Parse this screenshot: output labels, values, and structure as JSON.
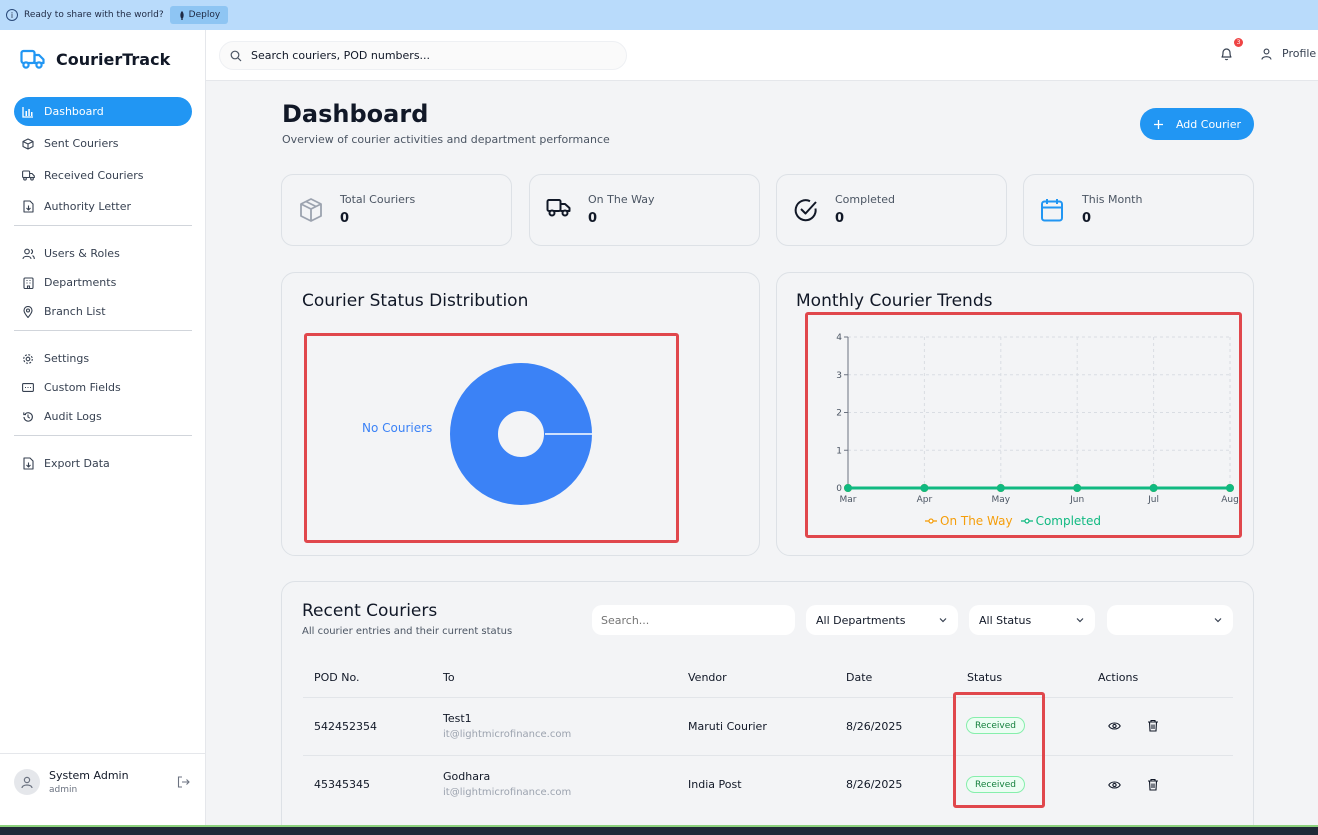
{
  "banner": {
    "text": "Ready to share with the world?",
    "deploy_label": "Deploy"
  },
  "brand": {
    "name": "CourierTrack",
    "accent": "#2196f3"
  },
  "sidebar": {
    "items": [
      {
        "label": "Dashboard",
        "icon": "bar-chart-icon",
        "active": true
      },
      {
        "label": "Sent Couriers",
        "icon": "box-icon"
      },
      {
        "label": "Received Couriers",
        "icon": "truck-icon"
      },
      {
        "label": "Authority Letter",
        "icon": "document-icon"
      },
      {
        "label": "Users & Roles",
        "icon": "users-icon"
      },
      {
        "label": "Departments",
        "icon": "building-icon"
      },
      {
        "label": "Branch List",
        "icon": "map-pin-icon"
      },
      {
        "label": "Settings",
        "icon": "gear-icon"
      },
      {
        "label": "Custom Fields",
        "icon": "form-field-icon"
      },
      {
        "label": "Audit Logs",
        "icon": "history-icon"
      },
      {
        "label": "Export Data",
        "icon": "export-icon"
      }
    ],
    "user": {
      "name": "System Admin",
      "role": "admin"
    }
  },
  "topbar": {
    "search_placeholder": "Search couriers, POD numbers...",
    "notification_count": "3",
    "profile_label": "Profile"
  },
  "header": {
    "title": "Dashboard",
    "subtitle": "Overview of courier activities and department performance",
    "add_button": "Add Courier"
  },
  "stats": [
    {
      "label": "Total Couriers",
      "value": "0",
      "icon": "box-icon"
    },
    {
      "label": "On The Way",
      "value": "0",
      "icon": "truck-icon"
    },
    {
      "label": "Completed",
      "value": "0",
      "icon": "check-circle-icon"
    },
    {
      "label": "This Month",
      "value": "0",
      "icon": "calendar-icon"
    }
  ],
  "status_chart": {
    "title": "Courier Status Distribution",
    "label": "No Couriers",
    "color": "#3b82f6"
  },
  "trend_chart": {
    "title": "Monthly Courier Trends",
    "legend": [
      "On The Way",
      "Completed"
    ],
    "colors": {
      "on_the_way": "#f59e0b",
      "completed": "#10b981"
    }
  },
  "chart_data": [
    {
      "type": "pie",
      "title": "Courier Status Distribution",
      "categories": [
        "No Couriers"
      ],
      "values": [
        1
      ]
    },
    {
      "type": "line",
      "title": "Monthly Courier Trends",
      "x": [
        "Mar",
        "Apr",
        "May",
        "Jun",
        "Jul",
        "Aug"
      ],
      "series": [
        {
          "name": "On The Way",
          "values": [
            0,
            0,
            0,
            0,
            0,
            0
          ]
        },
        {
          "name": "Completed",
          "values": [
            0,
            0,
            0,
            0,
            0,
            0
          ]
        }
      ],
      "ylim": [
        0,
        4
      ],
      "yticks": [
        "0",
        "1",
        "2",
        "3",
        "4"
      ],
      "grid": true,
      "legend": "bottom"
    }
  ],
  "recent": {
    "title": "Recent Couriers",
    "subtitle": "All courier entries and their current status",
    "search_placeholder": "Search...",
    "department_filter": "All Departments",
    "status_filter": "All Status",
    "third_filter": "",
    "columns": [
      "POD No.",
      "To",
      "Vendor",
      "Date",
      "Status",
      "Actions"
    ],
    "rows": [
      {
        "pod": "542452354",
        "to_name": "Test1",
        "to_email": "it@lightmicrofinance.com",
        "vendor": "Maruti Courier",
        "date": "8/26/2025",
        "status": "Received"
      },
      {
        "pod": "45345345",
        "to_name": "Godhara",
        "to_email": "it@lightmicrofinance.com",
        "vendor": "India Post",
        "date": "8/26/2025",
        "status": "Received"
      }
    ]
  }
}
